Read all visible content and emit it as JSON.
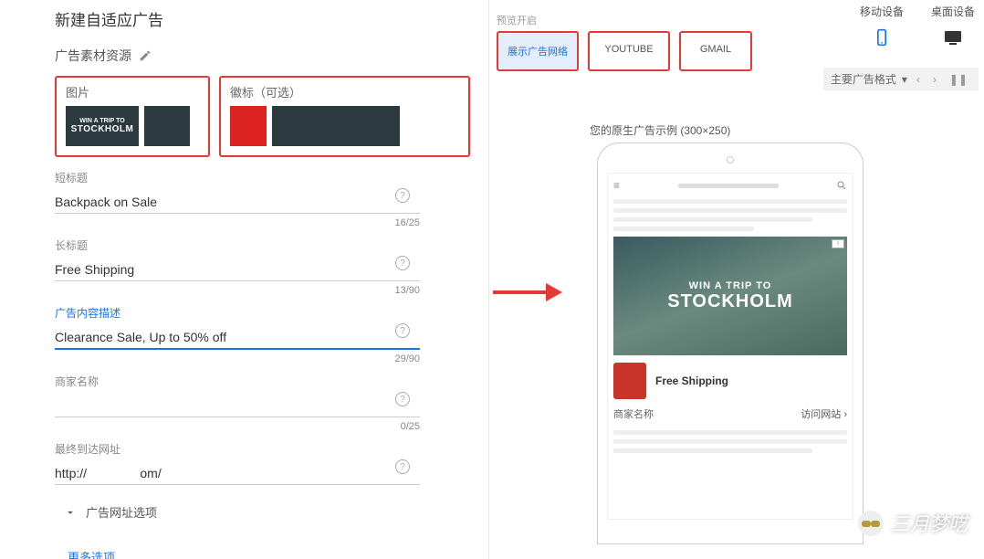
{
  "title": "新建自适应广告",
  "assets_label": "广告素材资源",
  "image_box": {
    "label": "图片",
    "overlay_top": "WIN A TRIP TO",
    "overlay_main": "STOCKHOLM"
  },
  "logo_box": {
    "label": "徽标（可选）"
  },
  "fields": {
    "short": {
      "label": "短标题",
      "value": "Backpack on Sale",
      "counter": "16/25"
    },
    "long": {
      "label": "长标题",
      "value": "Free Shipping",
      "counter": "13/90"
    },
    "desc": {
      "label": "广告内容描述",
      "value": "Clearance Sale, Up to 50% off",
      "counter": "29/90"
    },
    "biz": {
      "label": "商家名称",
      "value": "",
      "counter": "0/25"
    },
    "url": {
      "label": "最终到达网址",
      "value": "http://               om/"
    }
  },
  "expand_label": "广告网址选项",
  "more_label": "更多选项",
  "preview_head": "预览开启",
  "devices": {
    "mobile": "移动设备",
    "desktop": "桌面设备"
  },
  "placements": {
    "display": "展示广告网络",
    "youtube": "YOUTUBE",
    "gmail": "GMAIL"
  },
  "format_label": "主要广告格式",
  "caption": "您的原生广告示例 (300×250)",
  "ad": {
    "top": "WIN A TRIP TO",
    "main": "STOCKHOLM",
    "title": "Free Shipping",
    "biz": "商家名称",
    "visit": "访问网站"
  },
  "watermark": "三月梦呓"
}
